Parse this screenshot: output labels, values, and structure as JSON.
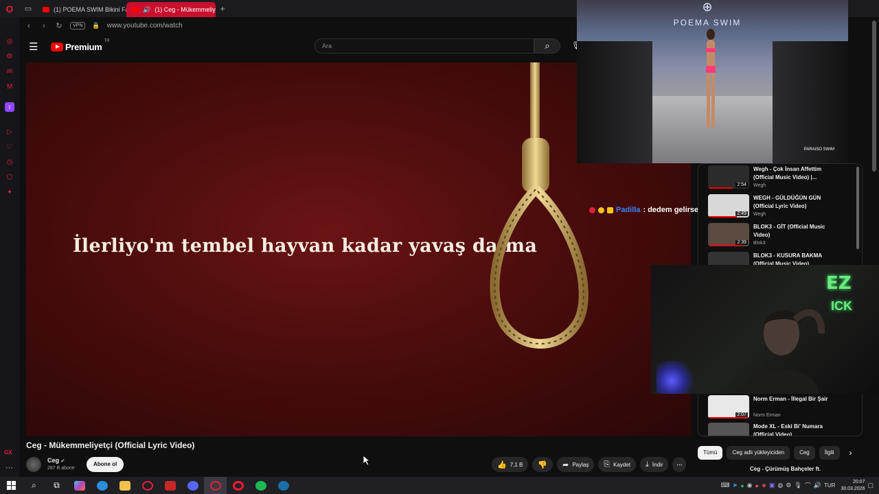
{
  "browser": {
    "tabs": [
      {
        "label": "(1) POEMA SWIM Bikini Fa",
        "active": false
      },
      {
        "label": "(1) Ceg - Mükemmeliye",
        "active": true
      }
    ],
    "url": "www.youtube.com/watch",
    "vpn_label": "VPN"
  },
  "youtube": {
    "logo_text": "Premium",
    "region": "TR",
    "search_placeholder": "Ara"
  },
  "player": {
    "lyric": "İlerliyo'm tembel hayvan kadar yavaş daima"
  },
  "pip": {
    "brand": "POEMA SWIM",
    "watermark": "PARAISO SWIM"
  },
  "chat": {
    "user": "Padilla",
    "message": ": dedem gelirse çıkarım..."
  },
  "video": {
    "title": "Ceg - Mükemmeliyetçi (Official Lyric Video)",
    "channel": "Ceg",
    "subscribers": "287 B abone",
    "subscribe_label": "Abone ol",
    "like_count": "7,1 B",
    "share_label": "Paylaş",
    "save_label": "Kaydet",
    "download_label": "İndir"
  },
  "recommendations": [
    {
      "title": "Wegh - Çok İnsan Affettim (Official Music Video) |...",
      "channel": "Wegh",
      "duration": "2:54",
      "progress": 0.6,
      "thumb": "#2b2b2b"
    },
    {
      "title": "WEGH - GÜLDÜĞÜN GÜN (Official Lyric Video)",
      "channel": "Wegh",
      "duration": "2:49",
      "progress": 0.7,
      "thumb": "#d8d8d8"
    },
    {
      "title": "BLOK3 - GİT (Official Music Video)",
      "channel": "Blok3",
      "duration": "2:39",
      "progress": 0.8,
      "thumb": "#5a4a40"
    },
    {
      "title": "BLOK3 - KUSURA BAKMA (Official Music Video)",
      "channel": "",
      "duration": "",
      "progress": 0,
      "thumb": "#333"
    },
    {
      "title": "Norm Erman - İllegal Bir Şair",
      "channel": "Norm Erman",
      "duration": "2:07",
      "progress": 1.0,
      "thumb": "#e8e8e8"
    },
    {
      "title": "Mode XL - Eski Bi' Numara (Official Video)",
      "channel": "",
      "duration": "",
      "progress": 0,
      "thumb": "#555"
    }
  ],
  "chips": [
    "Tümü",
    "Ceg adlı yükleyiciden",
    "Ceg",
    "İlgili"
  ],
  "next_item": "Ceg - Çürümüş Bahçeler ft.",
  "taskbar": {
    "lang": "TUR",
    "time": "20:07",
    "date": "30.03.2026"
  },
  "colors": {
    "accent": "#ff0000",
    "opera": "#e0203a",
    "overlay_green": "#6de87f"
  }
}
